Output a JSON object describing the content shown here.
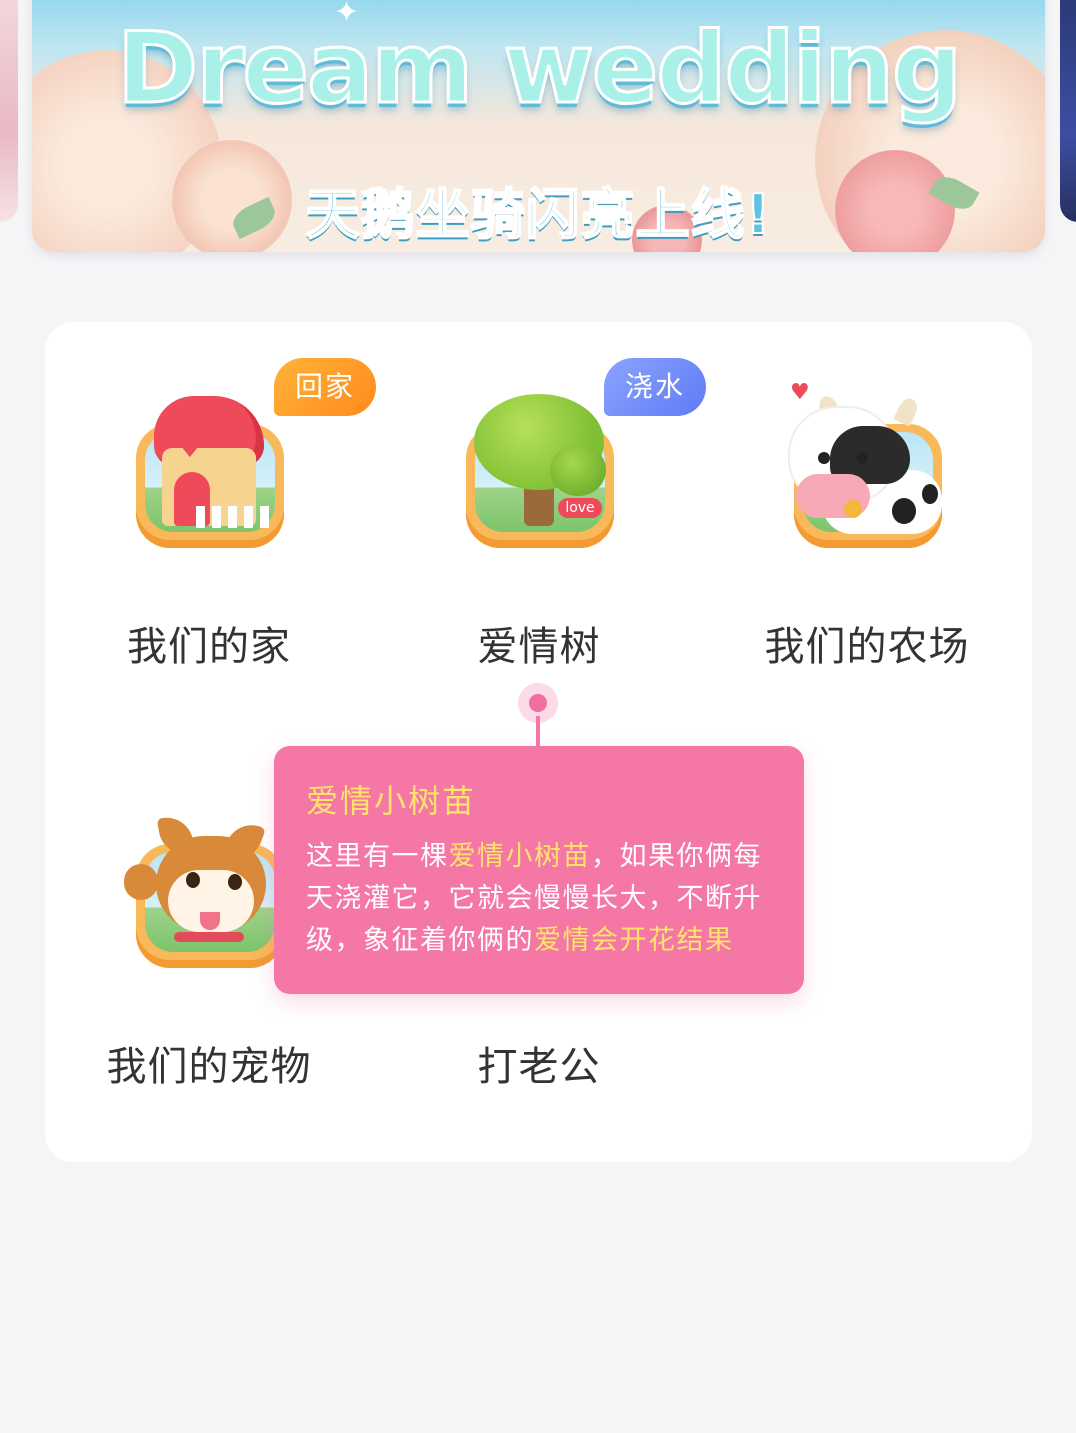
{
  "banner": {
    "title": "Dream wedding",
    "subtitle": "天鹅坐骑闪亮上线!"
  },
  "features": [
    {
      "label": "我们的家",
      "badge": "回家",
      "icon": "house-icon"
    },
    {
      "label": "爱情树",
      "badge": "浇水",
      "icon": "love-tree-icon"
    },
    {
      "label": "我们的农场",
      "icon": "cow-farm-icon"
    },
    {
      "label": "我们的宠物",
      "icon": "shiba-dog-icon"
    },
    {
      "label": "打老公",
      "icon": null
    }
  ],
  "tooltip": {
    "title": "爱情小树苗",
    "body_parts": [
      {
        "text": "这里有一棵",
        "highlight": false
      },
      {
        "text": "爱情小树苗",
        "highlight": true
      },
      {
        "text": "，如果你俩每天浇灌它，它就会慢慢长大，不断升级，象征着你俩的",
        "highlight": false
      },
      {
        "text": "爱情会开花结果",
        "highlight": true
      }
    ]
  },
  "colors": {
    "page_bg": "#f5f5f8",
    "card_bg": "#ffffff",
    "tooltip_bg": "#f477a6",
    "tooltip_highlight": "#ffe36b",
    "badge_orange": "#ff9a26",
    "badge_blue": "#6f88f8"
  }
}
